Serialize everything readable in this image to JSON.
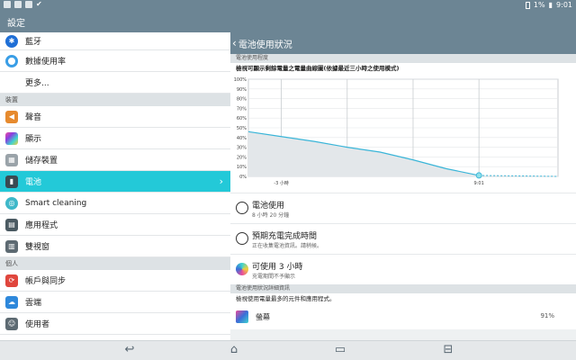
{
  "status": {
    "percent": "1%",
    "time": "9:01"
  },
  "app": {
    "title": "設定"
  },
  "sidebar": {
    "items_top": [
      {
        "label": "藍牙",
        "icon": "bluetooth-icon",
        "color": "#1f6fd6"
      },
      {
        "label": "數據使用率",
        "icon": "data-usage-icon",
        "color": "#3a9ee6"
      },
      {
        "label": "更多..."
      }
    ],
    "section_device": "裝置",
    "items_device": [
      {
        "label": "聲音",
        "icon": "sound-icon",
        "color": "#e68a2e"
      },
      {
        "label": "顯示",
        "icon": "display-icon",
        "color": "#b84fd6"
      },
      {
        "label": "儲存裝置",
        "icon": "storage-icon",
        "color": "#8a939a"
      },
      {
        "label": "電池",
        "icon": "battery-icon",
        "color": "#3a4a52",
        "selected": true
      },
      {
        "label": "Smart cleaning",
        "icon": "smart-cleaning-icon",
        "color": "#3fb8c9"
      },
      {
        "label": "應用程式",
        "icon": "apps-icon",
        "color": "#4b5a62"
      },
      {
        "label": "雙視窗",
        "icon": "dual-window-icon",
        "color": "#5d6a72"
      }
    ],
    "section_personal": "個人",
    "items_personal": [
      {
        "label": "帳戶與同步",
        "icon": "accounts-sync-icon",
        "color": "#e0463d"
      },
      {
        "label": "雲端",
        "icon": "cloud-icon",
        "color": "#2e88db"
      },
      {
        "label": "使用者",
        "icon": "users-icon",
        "color": "#5d6a72"
      }
    ]
  },
  "battery": {
    "header": "電池使用狀況",
    "level_section": "電池使用程度",
    "level_desc": "檢視可顯示剩餘電量之電量曲線圖(依據最近三小時之使用模式)",
    "usage_title": "電池使用",
    "usage_time": "8 小時 20 分鐘",
    "estimate_title": "預期充電完成時間",
    "estimate_sub": "正在收集電池資訊。請稍候。",
    "available_title": "可使用 3 小時",
    "available_sub": "充電期間不予顯示",
    "details_section": "電池使用狀況詳細資訊",
    "details_desc": "檢視使用電量最多的元件和應用程式。",
    "component_label": "螢幕",
    "component_pct": "91%"
  },
  "chart_data": {
    "type": "area",
    "yticks": [
      "100%",
      "90%",
      "80%",
      "70%",
      "60%",
      "50%",
      "40%",
      "30%",
      "20%",
      "10%",
      "0%"
    ],
    "xticks": [
      "-3 小時",
      "9:01"
    ],
    "ylim": [
      0,
      100
    ],
    "x": [
      -3.5,
      -3.0,
      -2.5,
      -2.0,
      -1.5,
      -1.0,
      -0.5,
      0.0
    ],
    "values": [
      46,
      41,
      36,
      30,
      25,
      17,
      8,
      1
    ],
    "projection": [
      1,
      0
    ]
  },
  "colors": {
    "accent": "#23c9d8",
    "bar": "#6c8594",
    "line": "#3ab5d8"
  }
}
